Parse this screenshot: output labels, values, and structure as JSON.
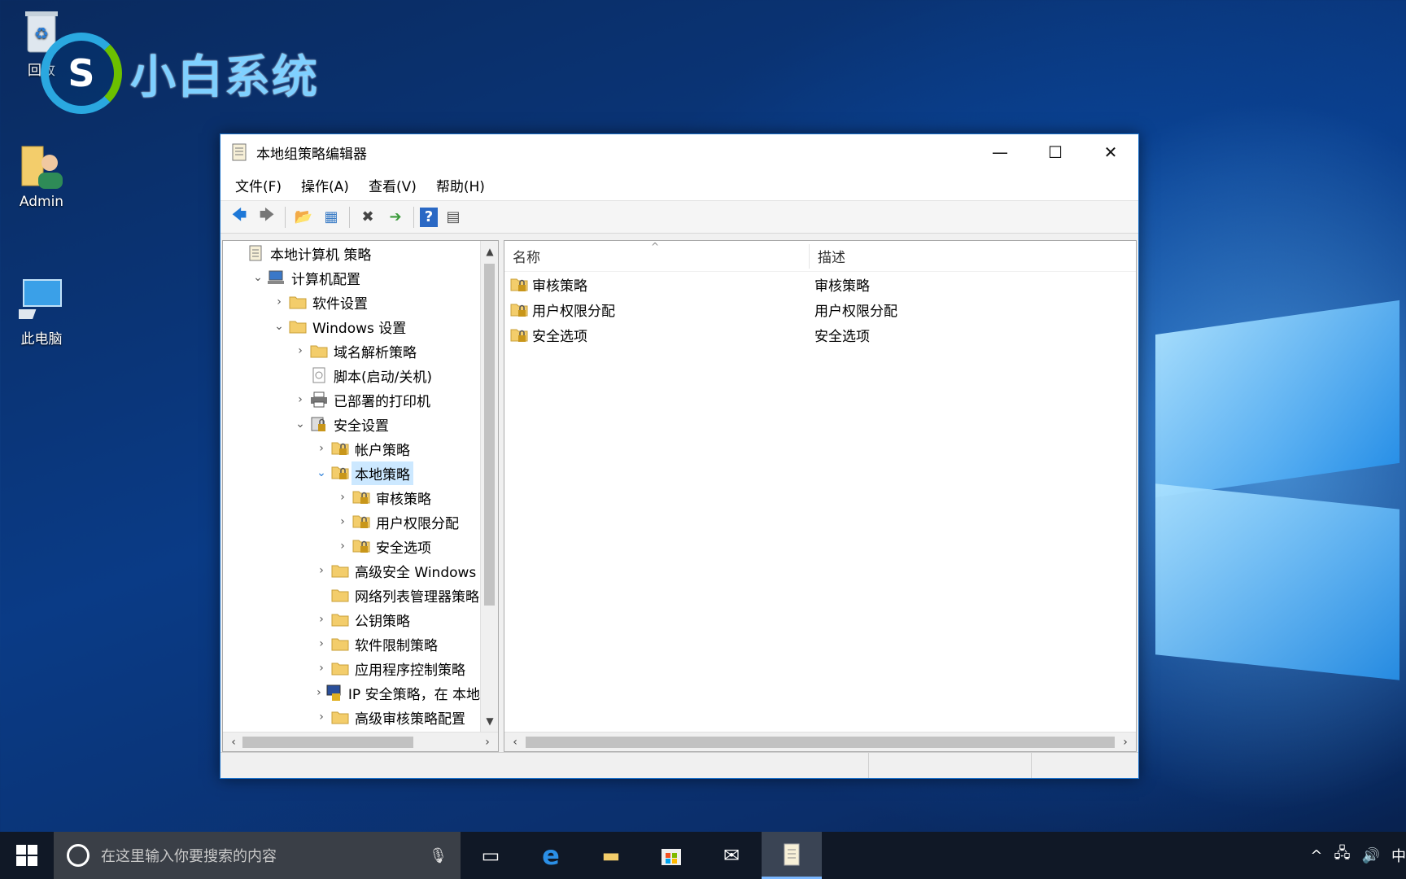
{
  "desktop": {
    "recycle_label": "回收",
    "admin_label": "Admin",
    "pc_label": "此电脑",
    "logo_text": "小白系统",
    "logo_letter": "S"
  },
  "window": {
    "title": "本地组策略编辑器",
    "controls": {
      "minimize": "—",
      "maximize": "☐",
      "close": "✕"
    },
    "menus": [
      "文件(F)",
      "操作(A)",
      "查看(V)",
      "帮助(H)"
    ],
    "toolbar": {
      "back": "🡄",
      "forward": "🡆",
      "up": "📂",
      "show": "▦",
      "delete": "✖",
      "export": "➔",
      "help": "?",
      "console": "▤"
    },
    "tree": [
      {
        "label": "本地计算机 策略",
        "indent": 0,
        "arrow": "",
        "icon": "scroll-icon"
      },
      {
        "label": "计算机配置",
        "indent": 1,
        "arrow": "⌄",
        "icon": "computer-icon"
      },
      {
        "label": "软件设置",
        "indent": 2,
        "arrow": "›",
        "icon": "folder-icon"
      },
      {
        "label": "Windows 设置",
        "indent": 2,
        "arrow": "⌄",
        "icon": "folder-icon"
      },
      {
        "label": "域名解析策略",
        "indent": 3,
        "arrow": "›",
        "icon": "folder-icon"
      },
      {
        "label": "脚本(启动/关机)",
        "indent": 3,
        "arrow": "",
        "icon": "script-icon"
      },
      {
        "label": "已部署的打印机",
        "indent": 3,
        "arrow": "›",
        "icon": "printer-icon"
      },
      {
        "label": "安全设置",
        "indent": 3,
        "arrow": "⌄",
        "icon": "security-icon"
      },
      {
        "label": "帐户策略",
        "indent": 4,
        "arrow": "›",
        "icon": "lock-folder-icon"
      },
      {
        "label": "本地策略",
        "indent": 4,
        "arrow": "⌄",
        "icon": "lock-folder-icon",
        "selected": true
      },
      {
        "label": "审核策略",
        "indent": 5,
        "arrow": "›",
        "icon": "lock-folder-icon"
      },
      {
        "label": "用户权限分配",
        "indent": 5,
        "arrow": "›",
        "icon": "lock-folder-icon"
      },
      {
        "label": "安全选项",
        "indent": 5,
        "arrow": "›",
        "icon": "lock-folder-icon"
      },
      {
        "label": "高级安全 Windows",
        "indent": 4,
        "arrow": "›",
        "icon": "folder-icon"
      },
      {
        "label": "网络列表管理器策略",
        "indent": 4,
        "arrow": "",
        "icon": "folder-icon"
      },
      {
        "label": "公钥策略",
        "indent": 4,
        "arrow": "›",
        "icon": "folder-icon"
      },
      {
        "label": "软件限制策略",
        "indent": 4,
        "arrow": "›",
        "icon": "folder-icon"
      },
      {
        "label": "应用程序控制策略",
        "indent": 4,
        "arrow": "›",
        "icon": "folder-icon"
      },
      {
        "label": "IP 安全策略，在 本地",
        "indent": 4,
        "arrow": "›",
        "icon": "ip-security-icon"
      },
      {
        "label": "高级审核策略配置",
        "indent": 4,
        "arrow": "›",
        "icon": "folder-icon"
      }
    ],
    "list": {
      "columns": [
        "名称",
        "描述"
      ],
      "sort_glyph": "^",
      "rows": [
        {
          "name": "审核策略",
          "desc": "审核策略"
        },
        {
          "name": "用户权限分配",
          "desc": "用户权限分配"
        },
        {
          "name": "安全选项",
          "desc": "安全选项"
        }
      ]
    }
  },
  "taskbar": {
    "search_placeholder": "在这里输入你要搜索的内容",
    "ime": "中",
    "apps": [
      "task-view-icon",
      "edge-icon",
      "file-explorer-icon",
      "store-icon",
      "mail-icon",
      "gpedit-icon"
    ]
  },
  "colors": {
    "selection": "#cce8ff",
    "window_border": "#1a6fc7",
    "folder": "#f3cd6b",
    "taskbar": "#101826"
  }
}
